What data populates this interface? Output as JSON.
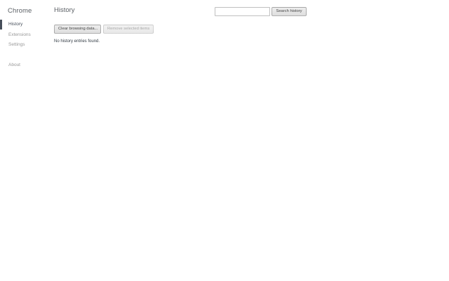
{
  "sidebar": {
    "brand": "Chrome",
    "items": [
      {
        "label": "History",
        "selected": true
      },
      {
        "label": "Extensions",
        "selected": false
      },
      {
        "label": "Settings",
        "selected": false
      }
    ],
    "about_label": "About"
  },
  "main": {
    "title": "History",
    "search": {
      "value": "",
      "placeholder": "",
      "button_label": "Search history"
    },
    "actions": {
      "clear_label": "Clear browsing data...",
      "remove_label": "Remove selected items",
      "remove_enabled": false
    },
    "empty_message": "No history entries found."
  },
  "colors": {
    "selected_indicator": "#464e5a",
    "nav_inactive": "#999999",
    "title_text": "#5c6166"
  }
}
